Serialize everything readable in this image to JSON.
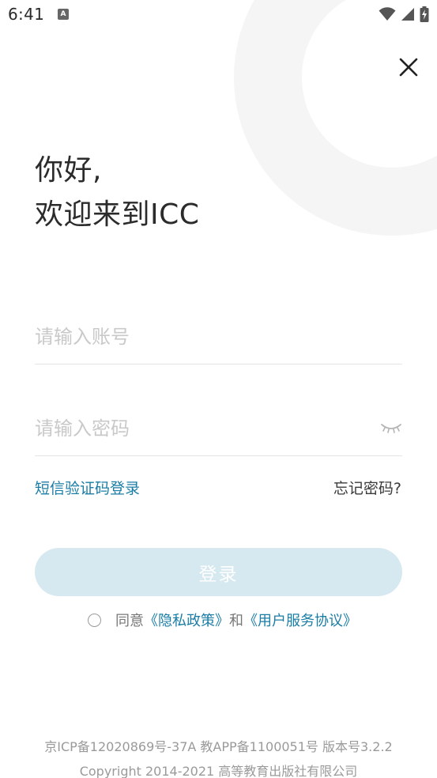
{
  "status_bar": {
    "time": "6:41",
    "notification_icon_letter": "A",
    "icons": [
      "wifi-icon",
      "signal-icon",
      "battery-charging-icon"
    ]
  },
  "greeting": {
    "line1": "你好,",
    "line2": "欢迎来到ICC"
  },
  "form": {
    "account_placeholder": "请输入账号",
    "account_value": "",
    "password_placeholder": "请输入密码",
    "password_value": ""
  },
  "links": {
    "sms_login": "短信验证码登录",
    "forgot_password": "忘记密码?"
  },
  "login_button": "登录",
  "agreement": {
    "checked": false,
    "prefix": "同意",
    "privacy_policy": "《隐私政策》",
    "and": "和",
    "user_agreement": "《用户服务协议》"
  },
  "footer": {
    "line1": "京ICP备12020869号-37A  教APP备1100051号  版本号3.2.2",
    "line2": "Copyright 2014-2021 高等教育出版社有限公司"
  },
  "colors": {
    "accent": "#1a7da5",
    "button_disabled_bg": "#d6e9f0",
    "placeholder": "#c9c9c9",
    "decor_arc": "#f5f5f5"
  }
}
